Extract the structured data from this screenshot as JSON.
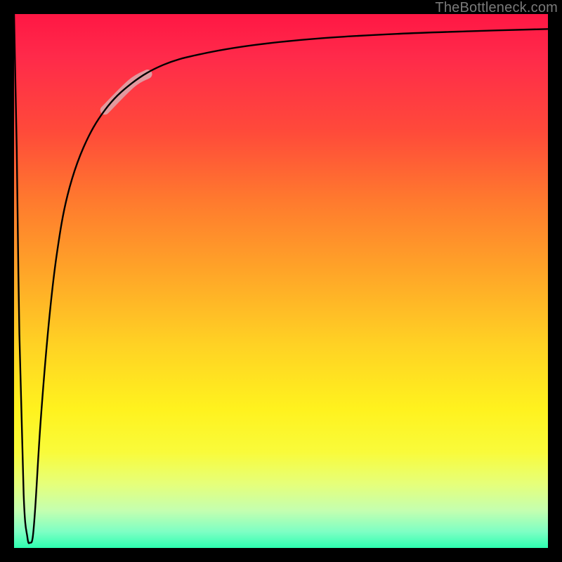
{
  "attribution": "TheBottleneck.com",
  "chart_data": {
    "type": "line",
    "title": "",
    "xlabel": "",
    "ylabel": "",
    "xlim": [
      0,
      100
    ],
    "ylim": [
      0,
      100
    ],
    "grid": false,
    "legend": false,
    "series": [
      {
        "name": "bottleneck-curve",
        "x": [
          0.0,
          0.5,
          1.0,
          1.8,
          2.5,
          3.0,
          3.5,
          4.0,
          5.0,
          6.5,
          8.0,
          10.0,
          13.0,
          17.0,
          22.0,
          28.0,
          35.0,
          45.0,
          58.0,
          72.0,
          86.0,
          100.0
        ],
        "y": [
          100.0,
          75.0,
          40.0,
          10.0,
          2.0,
          1.0,
          2.0,
          8.0,
          24.0,
          42.0,
          55.0,
          66.0,
          75.0,
          82.0,
          87.0,
          90.5,
          92.5,
          94.2,
          95.5,
          96.3,
          96.8,
          97.2
        ]
      }
    ],
    "highlight_segment": {
      "series": "bottleneck-curve",
      "x_start": 17.0,
      "x_end": 25.0
    },
    "background": {
      "type": "vertical-gradient",
      "stops": [
        {
          "pos": 0.0,
          "color": "#ff1744"
        },
        {
          "pos": 0.35,
          "color": "#ff7a2e"
        },
        {
          "pos": 0.62,
          "color": "#ffd224"
        },
        {
          "pos": 0.82,
          "color": "#f9fb3a"
        },
        {
          "pos": 0.97,
          "color": "#7dffc4"
        },
        {
          "pos": 1.0,
          "color": "#2dffb0"
        }
      ]
    }
  }
}
